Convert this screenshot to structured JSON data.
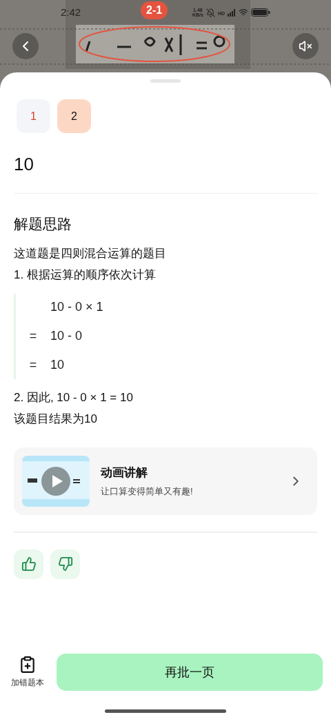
{
  "status_bar": {
    "time": "2:42",
    "speed": "1.48",
    "speed_unit": "KB/s",
    "network": "HD"
  },
  "photo": {
    "badge": "2-1"
  },
  "tabs": [
    {
      "label": "1",
      "selected": false,
      "wrong": true
    },
    {
      "label": "2",
      "selected": true,
      "wrong": false
    }
  ],
  "answer": "10",
  "section_title": "解题思路",
  "lines_before": [
    "这道题是四则混合运算的题目",
    "1. 根据运算的顺序依次计算"
  ],
  "steps": [
    {
      "expr": "10 - 0 × 1"
    },
    {
      "sign": "=",
      "expr": "10 - 0"
    },
    {
      "sign": "=",
      "expr": "10"
    }
  ],
  "lines_after": [
    "2. 因此, 10 - 0 × 1 = 10",
    "该题目结果为10"
  ],
  "video_card": {
    "title": "动画讲解",
    "subtitle": "让口算变得简单又有趣!"
  },
  "bottom_bar": {
    "add_label": "加错题本",
    "primary_button": "再批一页"
  }
}
